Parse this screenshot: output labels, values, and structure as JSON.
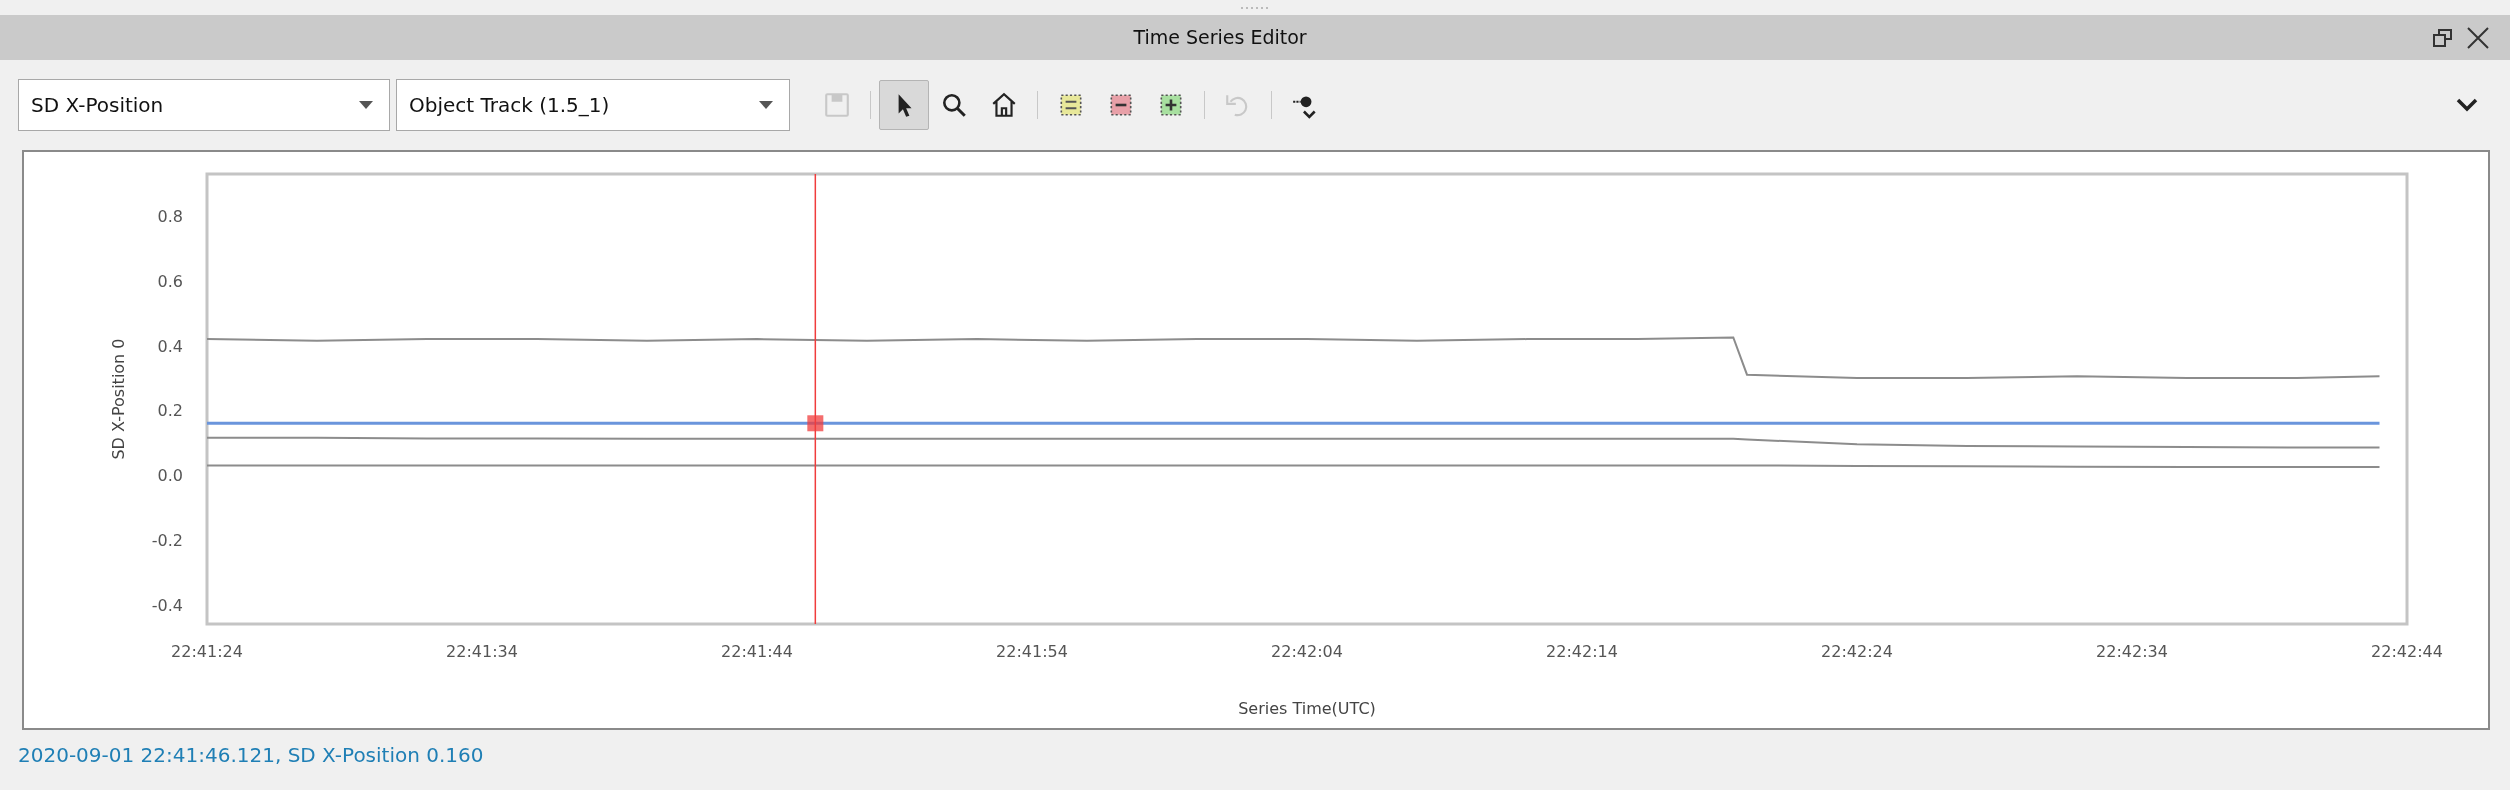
{
  "window": {
    "title": "Time Series Editor"
  },
  "toolbar": {
    "dropdowns": [
      {
        "value": "SD X-Position"
      },
      {
        "value": "Object Track (1.5_1)"
      }
    ],
    "tools": [
      {
        "kind": "save",
        "selected": false,
        "disabled": true
      },
      {
        "kind": "separator"
      },
      {
        "kind": "pointer",
        "selected": true,
        "disabled": false
      },
      {
        "kind": "zoom",
        "selected": false,
        "disabled": false
      },
      {
        "kind": "home",
        "selected": false,
        "disabled": false
      },
      {
        "kind": "separator"
      },
      {
        "kind": "range",
        "selected": false,
        "disabled": false
      },
      {
        "kind": "range-remove",
        "selected": false,
        "disabled": false
      },
      {
        "kind": "range-add",
        "selected": false,
        "disabled": false
      },
      {
        "kind": "separator"
      },
      {
        "kind": "undo",
        "selected": false,
        "disabled": true
      },
      {
        "kind": "separator"
      },
      {
        "kind": "point-menu",
        "selected": false,
        "disabled": false
      }
    ]
  },
  "chart": {
    "chart_data": {
      "type": "line",
      "xlabel": "Series Time(UTC)",
      "ylabel": "SD X-Position 0",
      "x": [
        81684,
        81688,
        81692,
        81696,
        81700,
        81704,
        81708,
        81712,
        81716,
        81720,
        81724,
        81728,
        81732,
        81736,
        81739.5,
        81740,
        81744,
        81748,
        81752,
        81756,
        81760,
        81763
      ],
      "series": [
        {
          "color": "#8c8c8c",
          "values": [
            0.42,
            0.415,
            0.42,
            0.42,
            0.415,
            0.42,
            0.415,
            0.42,
            0.415,
            0.42,
            0.42,
            0.415,
            0.42,
            0.42,
            0.425,
            0.31,
            0.3,
            0.3,
            0.305,
            0.3,
            0.3,
            0.305
          ]
        },
        {
          "color": "#6a95dc",
          "values": [
            0.16,
            0.16,
            0.16,
            0.16,
            0.16,
            0.16,
            0.16,
            0.16,
            0.16,
            0.16,
            0.16,
            0.16,
            0.16,
            0.16,
            0.16,
            0.16,
            0.16,
            0.16,
            0.16,
            0.16,
            0.16,
            0.16
          ]
        },
        {
          "color": "#8c8c8c",
          "values": [
            0.115,
            0.115,
            0.113,
            0.113,
            0.112,
            0.112,
            0.112,
            0.112,
            0.112,
            0.112,
            0.112,
            0.112,
            0.112,
            0.112,
            0.112,
            0.11,
            0.095,
            0.09,
            0.088,
            0.087,
            0.085,
            0.085
          ]
        },
        {
          "color": "#8c8c8c",
          "values": [
            0.03,
            0.03,
            0.03,
            0.03,
            0.03,
            0.03,
            0.03,
            0.03,
            0.03,
            0.03,
            0.03,
            0.03,
            0.03,
            0.03,
            0.03,
            0.03,
            0.028,
            0.027,
            0.026,
            0.025,
            0.025,
            0.025
          ]
        }
      ],
      "xlim": [
        81684,
        81764
      ],
      "ylim": [
        -0.46,
        0.93
      ],
      "xticks": [
        {
          "value": 81684,
          "label": "22:41:24"
        },
        {
          "value": 81694,
          "label": "22:41:34"
        },
        {
          "value": 81704,
          "label": "22:41:44"
        },
        {
          "value": 81714,
          "label": "22:41:54"
        },
        {
          "value": 81724,
          "label": "22:42:04"
        },
        {
          "value": 81734,
          "label": "22:42:14"
        },
        {
          "value": 81744,
          "label": "22:42:24"
        },
        {
          "value": 81754,
          "label": "22:42:34"
        },
        {
          "value": 81764,
          "label": "22:42:44"
        }
      ],
      "yticks": [
        {
          "value": 0.8,
          "label": "0.8"
        },
        {
          "value": 0.6,
          "label": "0.6"
        },
        {
          "value": 0.4,
          "label": "0.4"
        },
        {
          "value": 0.2,
          "label": "0.2"
        },
        {
          "value": 0,
          "label": "0.0"
        },
        {
          "value": -0.2,
          "label": "-0.2"
        },
        {
          "value": -0.4,
          "label": "-0.4"
        }
      ],
      "ref_lines": [
        {
          "axis": "x",
          "value": 81706.121,
          "color": "#f03c3c"
        }
      ]
    }
  },
  "status_bar": {
    "text": "2020-09-01 22:41:46.121, SD X-Position 0.160"
  }
}
